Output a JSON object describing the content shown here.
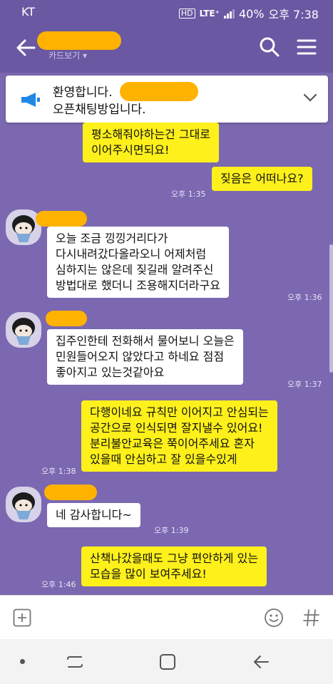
{
  "status": {
    "carrier": "KT",
    "hd": "HD",
    "lte": "LTE⁺",
    "battery": "40%",
    "time": "오후 7:38"
  },
  "header": {
    "subtitle": "카드보기 ▾"
  },
  "notice": {
    "line1": "환영합니다.",
    "line2": "오픈채팅방입니다."
  },
  "messages": [
    {
      "from": "me",
      "lines": [
        "평소해줘야하는건 그대로",
        "이어주시면되요!"
      ],
      "time": ""
    },
    {
      "from": "me",
      "lines": [
        "짖음은 어떠나요?"
      ],
      "time": "오후 1:35"
    },
    {
      "from": "other",
      "lines": [
        "오늘 조금 낑낑거리다가",
        "다시내려갔다올라오니 어제처럼",
        "심하지는 않은데 짖길래 알려주신",
        "방법대로 했더니 조용해지더라구요"
      ],
      "time": "오후 1:36"
    },
    {
      "from": "other",
      "lines": [
        "집주인한테 전화해서 물어보니 오늘은",
        "민원들어오지 않았다고 하네요 점점",
        "좋아지고 있는것같아요"
      ],
      "time": "오후 1:37"
    },
    {
      "from": "me",
      "lines": [
        "다행이네요 규칙만 이어지고 안심되는",
        "공간으로 인식되면 잘지낼수 있어요!",
        "분리불안교육은 쭉이어주세요 혼자",
        "있을때 안심하고 잘 있을수있게"
      ],
      "time": "오후 1:38"
    },
    {
      "from": "other",
      "lines": [
        "네 감사합니다~"
      ],
      "time": "오후 1:39"
    },
    {
      "from": "me",
      "lines": [
        "산책나갔을때도 그냥 편안하게 있는",
        "모습을 많이 보여주세요!"
      ],
      "time": "오후 1:46"
    }
  ],
  "colors": {
    "bg": "#7b68b0",
    "me_bubble": "#fef01b",
    "other_bubble": "#ffffff",
    "redaction": "#ffb200"
  },
  "icons": {
    "back": "back-arrow-icon",
    "search": "search-icon",
    "menu": "hamburger-menu-icon",
    "notice": "megaphone-icon",
    "expand": "chevron-down-icon",
    "attach": "plus-square-icon",
    "emoji": "emoji-icon",
    "hash": "hash-icon"
  }
}
